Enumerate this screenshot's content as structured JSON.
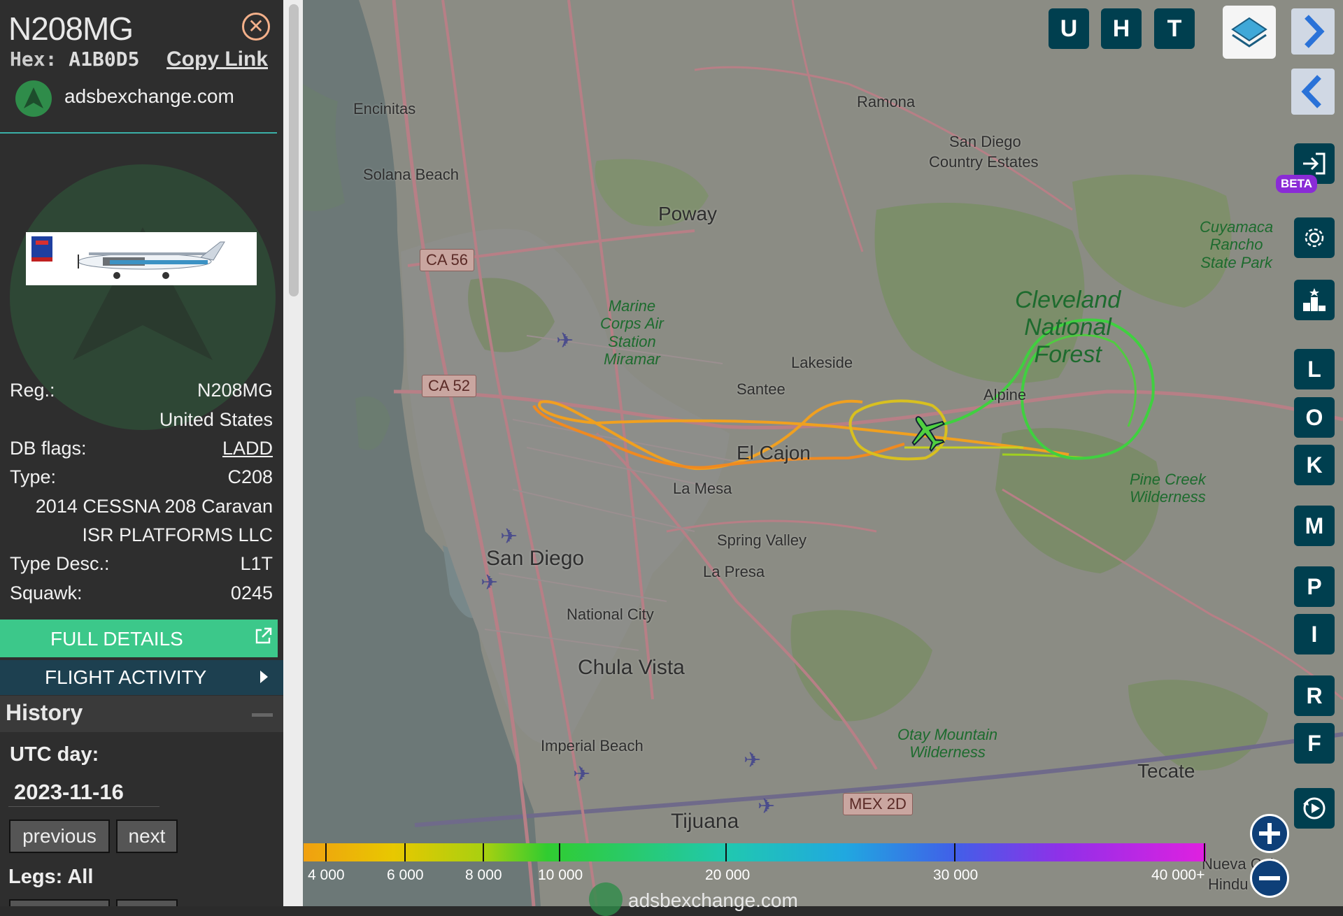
{
  "aircraft": {
    "callsign": "N208MG",
    "hex_label": "Hex:",
    "hex": "A1B0D5",
    "copy_link": "Copy Link",
    "site": "adsbexchange.com"
  },
  "details": [
    {
      "key": "Reg.:",
      "value": "N208MG"
    },
    {
      "key": "",
      "value": "United States"
    },
    {
      "key": "DB flags:",
      "value": "LADD"
    },
    {
      "key": "Type:",
      "value": "C208"
    },
    {
      "key": "",
      "value": "2014 CESSNA 208 Caravan"
    },
    {
      "key": "",
      "value": "ISR PLATFORMS LLC"
    },
    {
      "key": "Type Desc.:",
      "value": "L1T"
    },
    {
      "key": "Squawk:",
      "value": "0245"
    }
  ],
  "actions": {
    "full_details": "FULL DETAILS",
    "flight_activity": "FLIGHT ACTIVITY"
  },
  "history": {
    "title": "History",
    "utc_label": "UTC day:",
    "utc_day": "2023-11-16",
    "previous": "previous",
    "next": "next",
    "legs_label": "Legs: All"
  },
  "map": {
    "places": [
      {
        "name": "Encinitas"
      },
      {
        "name": "Solana Beach"
      },
      {
        "name": "Ramona"
      },
      {
        "name": "San Diego"
      },
      {
        "name": "Country Estates"
      },
      {
        "name": "Poway"
      },
      {
        "name": "Lakeside"
      },
      {
        "name": "Santee"
      },
      {
        "name": "Alpine"
      },
      {
        "name": "El Cajon"
      },
      {
        "name": "La Mesa"
      },
      {
        "name": "Spring Valley"
      },
      {
        "name": "La Presa"
      },
      {
        "name": "San Diego"
      },
      {
        "name": "National City"
      },
      {
        "name": "Chula Vista"
      },
      {
        "name": "Imperial Beach"
      },
      {
        "name": "Tijuana"
      },
      {
        "name": "Tecate"
      },
      {
        "name": "Nueva Colo"
      },
      {
        "name": "Hindu"
      }
    ],
    "parks": {
      "marine": [
        "Marine",
        "Corps Air",
        "Station",
        "Miramar"
      ],
      "cleveland": [
        "Cleveland",
        "National",
        "Forest"
      ],
      "cuyamaca": [
        "Cuyamaca",
        "Rancho",
        "State Park"
      ],
      "pine_creek": [
        "Pine Creek",
        "Wilderness"
      ],
      "otay": [
        "Otay Mountain",
        "Wilderness"
      ]
    },
    "shields": [
      "CA 56",
      "CA 52",
      "MEX 2D"
    ],
    "footer": "adsbexchange.com"
  },
  "toolbar": {
    "top_buttons": [
      "U",
      "H",
      "T"
    ],
    "side_buttons": [
      "L",
      "O",
      "K",
      "M",
      "P",
      "I",
      "R",
      "F"
    ],
    "beta": "BETA"
  },
  "altitude_legend": {
    "labels": [
      "4 000",
      "6 000",
      "8 000",
      "10 000",
      "20 000",
      "30 000",
      "40 000+"
    ]
  },
  "icons": [
    "close-icon",
    "external-link-icon",
    "layers-icon",
    "chevron-right-icon",
    "chevron-left-icon",
    "login-icon",
    "gear-icon",
    "podium-icon",
    "replay-icon",
    "zoom-in-icon",
    "zoom-out-icon",
    "plane-icon",
    "airport-icon"
  ]
}
